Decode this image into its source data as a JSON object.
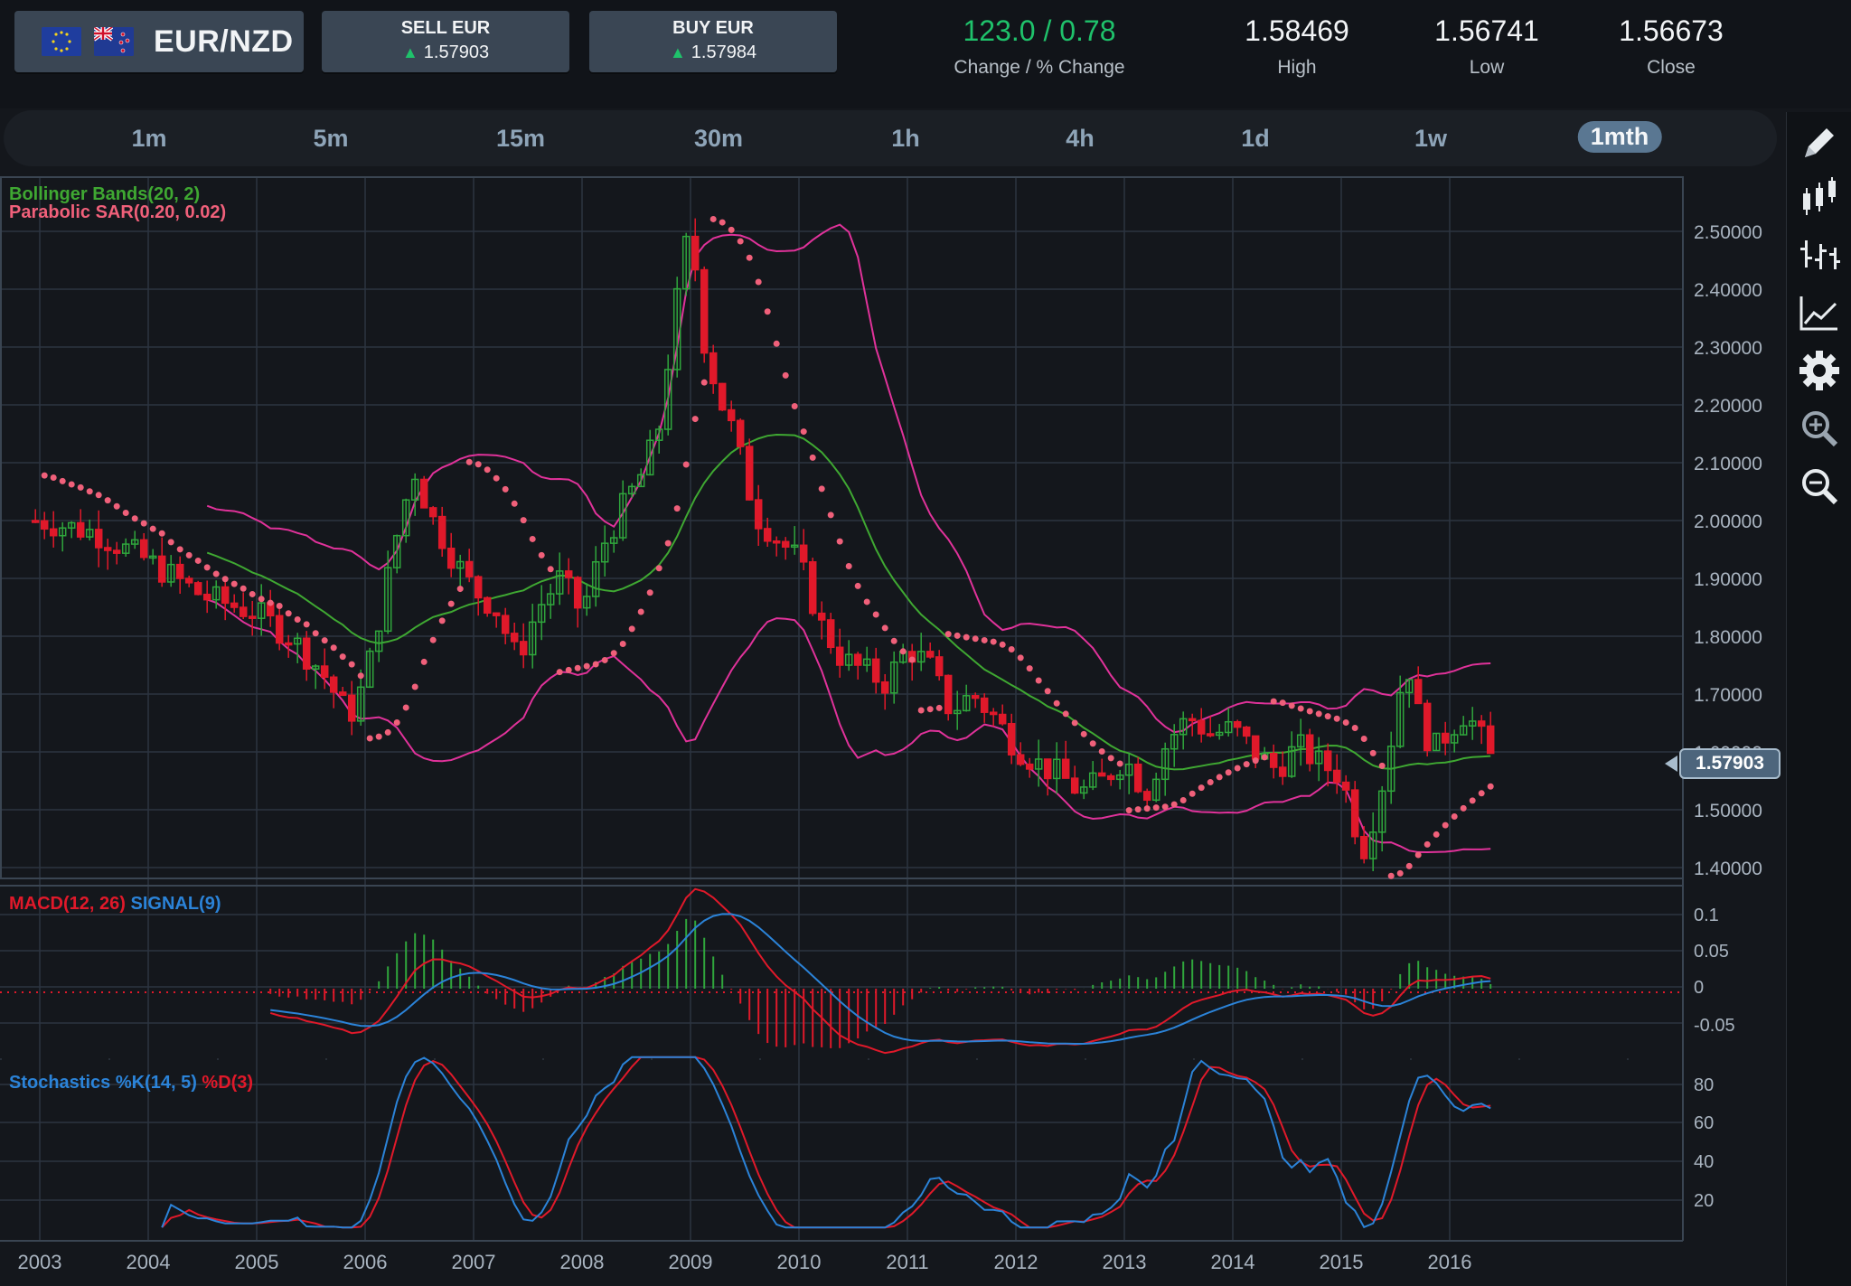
{
  "header": {
    "pair": "EUR/NZD",
    "sell": {
      "label": "SELL EUR",
      "value": "1.57903"
    },
    "buy": {
      "label": "BUY EUR",
      "value": "1.57984"
    },
    "change": {
      "value": "123.0 / 0.78",
      "label": "Change / % Change"
    },
    "high": {
      "value": "1.58469",
      "label": "High"
    },
    "low": {
      "value": "1.56741",
      "label": "Low"
    },
    "close": {
      "value": "1.56673",
      "label": "Close"
    }
  },
  "timeframes": [
    "1m",
    "5m",
    "15m",
    "30m",
    "1h",
    "4h",
    "1d",
    "1w",
    "1mth"
  ],
  "active_timeframe": "1mth",
  "tools": [
    "pencil-icon",
    "candlestick-icon",
    "bar-chart-icon",
    "line-chart-icon",
    "gear-icon",
    "zoom-in-icon",
    "zoom-out-icon"
  ],
  "indicators": {
    "bollinger": "Bollinger Bands(20, 2)",
    "sar": "Parabolic SAR(0.20, 0.02)",
    "macd": "MACD(12, 26)",
    "signal": "SIGNAL(9)",
    "stoch_k": "Stochastics %K(14, 5)",
    "stoch_d": "%D(3)"
  },
  "current_price": "1.57903",
  "colors": {
    "up": "#1f8a2e",
    "down": "#e0192a",
    "boll_band": "#e0329a",
    "boll_mid": "#3fa832",
    "sar": "#f0607a",
    "macd": "#e0192a",
    "signal": "#2b83d8"
  },
  "chart_data": {
    "type": "candlestick",
    "x_ticks": [
      "2003",
      "2004",
      "2005",
      "2006",
      "2007",
      "2008",
      "2009",
      "2010",
      "2011",
      "2012",
      "2013",
      "2014",
      "2015",
      "2016"
    ],
    "price_axis": {
      "ticks": [
        "2.50000",
        "2.40000",
        "2.30000",
        "2.20000",
        "2.10000",
        "2.00000",
        "1.90000",
        "1.80000",
        "1.70000",
        "1.60000",
        "1.50000",
        "1.40000"
      ],
      "range": [
        1.38,
        2.59
      ]
    },
    "price_series": [
      {
        "t": 2003.0,
        "c": 2.0
      },
      {
        "t": 2003.5,
        "c": 1.98
      },
      {
        "t": 2004.0,
        "c": 1.93
      },
      {
        "t": 2004.5,
        "c": 1.87
      },
      {
        "t": 2005.0,
        "c": 1.84
      },
      {
        "t": 2005.3,
        "c": 1.8
      },
      {
        "t": 2005.6,
        "c": 1.74
      },
      {
        "t": 2005.85,
        "c": 1.66
      },
      {
        "t": 2006.0,
        "c": 1.72
      },
      {
        "t": 2006.15,
        "c": 1.85
      },
      {
        "t": 2006.3,
        "c": 1.98
      },
      {
        "t": 2006.45,
        "c": 2.09
      },
      {
        "t": 2006.6,
        "c": 2.01
      },
      {
        "t": 2006.8,
        "c": 1.94
      },
      {
        "t": 2007.0,
        "c": 1.88
      },
      {
        "t": 2007.2,
        "c": 1.85
      },
      {
        "t": 2007.4,
        "c": 1.76
      },
      {
        "t": 2007.6,
        "c": 1.85
      },
      {
        "t": 2007.8,
        "c": 1.9
      },
      {
        "t": 2008.0,
        "c": 1.84
      },
      {
        "t": 2008.2,
        "c": 1.96
      },
      {
        "t": 2008.4,
        "c": 2.03
      },
      {
        "t": 2008.55,
        "c": 2.08
      },
      {
        "t": 2008.7,
        "c": 2.15
      },
      {
        "t": 2008.85,
        "c": 2.35
      },
      {
        "t": 2009.0,
        "c": 2.52
      },
      {
        "t": 2009.1,
        "c": 2.33
      },
      {
        "t": 2009.25,
        "c": 2.22
      },
      {
        "t": 2009.4,
        "c": 2.15
      },
      {
        "t": 2009.6,
        "c": 2.01
      },
      {
        "t": 2009.8,
        "c": 1.97
      },
      {
        "t": 2010.0,
        "c": 1.93
      },
      {
        "t": 2010.2,
        "c": 1.82
      },
      {
        "t": 2010.4,
        "c": 1.76
      },
      {
        "t": 2010.6,
        "c": 1.74
      },
      {
        "t": 2010.8,
        "c": 1.72
      },
      {
        "t": 2011.0,
        "c": 1.78
      },
      {
        "t": 2011.2,
        "c": 1.75
      },
      {
        "t": 2011.4,
        "c": 1.67
      },
      {
        "t": 2011.6,
        "c": 1.7
      },
      {
        "t": 2011.8,
        "c": 1.66
      },
      {
        "t": 2012.0,
        "c": 1.61
      },
      {
        "t": 2012.2,
        "c": 1.58
      },
      {
        "t": 2012.4,
        "c": 1.56
      },
      {
        "t": 2012.6,
        "c": 1.53
      },
      {
        "t": 2012.8,
        "c": 1.55
      },
      {
        "t": 2013.0,
        "c": 1.59
      },
      {
        "t": 2013.2,
        "c": 1.53
      },
      {
        "t": 2013.4,
        "c": 1.62
      },
      {
        "t": 2013.6,
        "c": 1.66
      },
      {
        "t": 2013.8,
        "c": 1.63
      },
      {
        "t": 2014.0,
        "c": 1.64
      },
      {
        "t": 2014.2,
        "c": 1.6
      },
      {
        "t": 2014.4,
        "c": 1.57
      },
      {
        "t": 2014.6,
        "c": 1.61
      },
      {
        "t": 2014.8,
        "c": 1.58
      },
      {
        "t": 2015.0,
        "c": 1.56
      },
      {
        "t": 2015.1,
        "c": 1.49
      },
      {
        "t": 2015.2,
        "c": 1.43
      },
      {
        "t": 2015.35,
        "c": 1.52
      },
      {
        "t": 2015.5,
        "c": 1.66
      },
      {
        "t": 2015.6,
        "c": 1.77
      },
      {
        "t": 2015.7,
        "c": 1.67
      },
      {
        "t": 2015.85,
        "c": 1.6
      },
      {
        "t": 2016.0,
        "c": 1.64
      },
      {
        "t": 2016.15,
        "c": 1.67
      },
      {
        "t": 2016.3,
        "c": 1.62
      },
      {
        "t": 2016.4,
        "c": 1.58
      }
    ],
    "macd_axis": {
      "ticks": [
        "0.1",
        "0.05",
        "0",
        "-0.05"
      ]
    },
    "stoch_axis": {
      "ticks": [
        "80",
        "60",
        "40",
        "20"
      ]
    }
  }
}
